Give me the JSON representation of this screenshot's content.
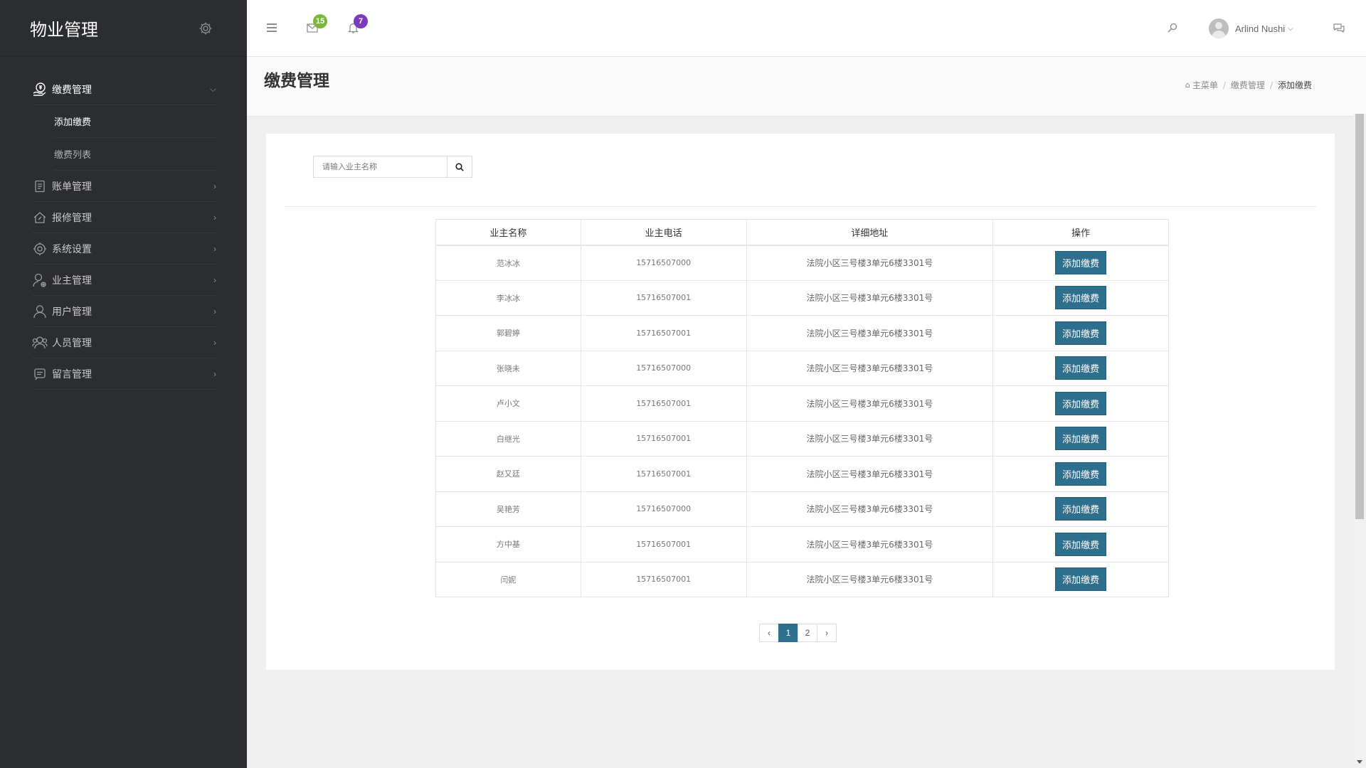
{
  "sidebar": {
    "title": "物业管理",
    "menu": [
      {
        "label": "缴费管理",
        "icon": "payment-hand-icon",
        "active": true,
        "expanded": true,
        "children": [
          {
            "label": "添加缴费",
            "active": true
          },
          {
            "label": "缴费列表",
            "active": false
          }
        ]
      },
      {
        "label": "账单管理",
        "icon": "bill-icon"
      },
      {
        "label": "报修管理",
        "icon": "repair-house-icon"
      },
      {
        "label": "系统设置",
        "icon": "settings-gear-icon"
      },
      {
        "label": "业主管理",
        "icon": "owner-user-icon"
      },
      {
        "label": "用户管理",
        "icon": "user-icon"
      },
      {
        "label": "人员管理",
        "icon": "staff-group-icon"
      },
      {
        "label": "留言管理",
        "icon": "message-icon"
      }
    ]
  },
  "topbar": {
    "mail_badge": "15",
    "bell_badge": "7",
    "user_name": "Arlind Nushi",
    "colors": {
      "mail_badge": "#7ab83c",
      "bell_badge": "#7c3bb8"
    }
  },
  "header": {
    "title": "缴费管理",
    "breadcrumb": [
      "主菜单",
      "缴费管理",
      "添加缴费"
    ]
  },
  "search": {
    "placeholder": "请输入业主名称"
  },
  "table": {
    "headers": [
      "业主名称",
      "业主电话",
      "详细地址",
      "操作"
    ],
    "action_label": "添加缴费",
    "rows": [
      {
        "name": "范冰冰",
        "phone": "15716507000",
        "address": "法院小区三号楼3单元6楼3301号"
      },
      {
        "name": "李冰冰",
        "phone": "15716507001",
        "address": "法院小区三号楼3单元6楼3301号"
      },
      {
        "name": "郭碧婷",
        "phone": "15716507001",
        "address": "法院小区三号楼3单元6楼3301号"
      },
      {
        "name": "张晓未",
        "phone": "15716507000",
        "address": "法院小区三号楼3单元6楼3301号"
      },
      {
        "name": "卢小文",
        "phone": "15716507001",
        "address": "法院小区三号楼3单元6楼3301号"
      },
      {
        "name": "白继光",
        "phone": "15716507001",
        "address": "法院小区三号楼3单元6楼3301号"
      },
      {
        "name": "赵又廷",
        "phone": "15716507001",
        "address": "法院小区三号楼3单元6楼3301号"
      },
      {
        "name": "吴艳芳",
        "phone": "15716507000",
        "address": "法院小区三号楼3单元6楼3301号"
      },
      {
        "name": "方中基",
        "phone": "15716507001",
        "address": "法院小区三号楼3单元6楼3301号"
      },
      {
        "name": "闫妮",
        "phone": "15716507001",
        "address": "法院小区三号楼3单元6楼3301号"
      }
    ]
  },
  "pagination": {
    "prev": "‹",
    "pages": [
      "1",
      "2"
    ],
    "current": "1",
    "next": "›"
  },
  "theme": {
    "sidebar_bg": "#2b2d31",
    "primary": "#2e6f8e"
  }
}
